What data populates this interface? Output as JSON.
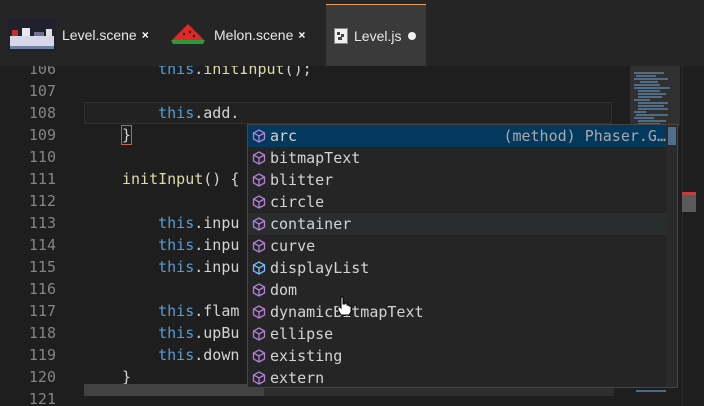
{
  "tabs": [
    {
      "label": "Level.scene",
      "close": "×",
      "thumb": "level-scene-thumbnail"
    },
    {
      "label": "Melon.scene",
      "close": "×",
      "thumb": "melon-thumbnail"
    },
    {
      "label": "Level.js",
      "thumb": "js-file-icon",
      "modified": true
    }
  ],
  "editor": {
    "lines": [
      {
        "n": "106",
        "code": [
          {
            "t": "    "
          },
          {
            "t": "this",
            "c": "kw"
          },
          {
            "t": "."
          },
          {
            "t": "initInput",
            "c": "fn"
          },
          {
            "t": "();"
          }
        ]
      },
      {
        "n": "107",
        "code": []
      },
      {
        "n": "108",
        "code": [
          {
            "t": "    "
          },
          {
            "t": "this",
            "c": "kw"
          },
          {
            "t": ".add."
          }
        ]
      },
      {
        "n": "109",
        "code": [
          {
            "t": "}",
            "c": "brace"
          }
        ]
      },
      {
        "n": "110",
        "code": []
      },
      {
        "n": "111",
        "code": [
          {
            "t": "initInput",
            "c": "fn"
          },
          {
            "t": "() {"
          }
        ]
      },
      {
        "n": "112",
        "code": []
      },
      {
        "n": "113",
        "code": [
          {
            "t": "    "
          },
          {
            "t": "this",
            "c": "kw"
          },
          {
            "t": ".inpu"
          }
        ]
      },
      {
        "n": "114",
        "code": [
          {
            "t": "    "
          },
          {
            "t": "this",
            "c": "kw"
          },
          {
            "t": ".inpu"
          }
        ]
      },
      {
        "n": "115",
        "code": [
          {
            "t": "    "
          },
          {
            "t": "this",
            "c": "kw"
          },
          {
            "t": ".inpu"
          }
        ]
      },
      {
        "n": "116",
        "code": []
      },
      {
        "n": "117",
        "code": [
          {
            "t": "    "
          },
          {
            "t": "this",
            "c": "kw"
          },
          {
            "t": ".flam"
          }
        ]
      },
      {
        "n": "118",
        "code": [
          {
            "t": "    "
          },
          {
            "t": "this",
            "c": "kw"
          },
          {
            "t": ".upBu"
          }
        ]
      },
      {
        "n": "119",
        "code": [
          {
            "t": "    "
          },
          {
            "t": "this",
            "c": "kw"
          },
          {
            "t": ".down"
          }
        ]
      },
      {
        "n": "120",
        "code": [
          {
            "t": "}"
          }
        ]
      },
      {
        "n": "121",
        "code": []
      }
    ]
  },
  "suggest": {
    "items": [
      {
        "label": "arc",
        "detail": "(method) Phaser.G…",
        "icon": "method-cube-icon",
        "state": "selected"
      },
      {
        "label": "bitmapText",
        "icon": "method-cube-icon"
      },
      {
        "label": "blitter",
        "icon": "method-cube-icon"
      },
      {
        "label": "circle",
        "icon": "method-cube-icon"
      },
      {
        "label": "container",
        "icon": "method-cube-icon",
        "state": "hover"
      },
      {
        "label": "curve",
        "icon": "method-cube-icon"
      },
      {
        "label": "displayList",
        "icon": "field-cube-icon"
      },
      {
        "label": "dom",
        "icon": "method-cube-icon"
      },
      {
        "label": "dynamicBitmapText",
        "icon": "method-cube-icon"
      },
      {
        "label": "ellipse",
        "icon": "method-cube-icon"
      },
      {
        "label": "existing",
        "icon": "method-cube-icon"
      },
      {
        "label": "extern",
        "icon": "method-cube-icon"
      }
    ]
  },
  "colors": {
    "keyword": "#569cd6",
    "function": "#dcdcaa",
    "method_icon": "#b180d7",
    "field_icon": "#75beff",
    "selected_bg": "#04395e",
    "tab_accent": "#e8a060"
  }
}
